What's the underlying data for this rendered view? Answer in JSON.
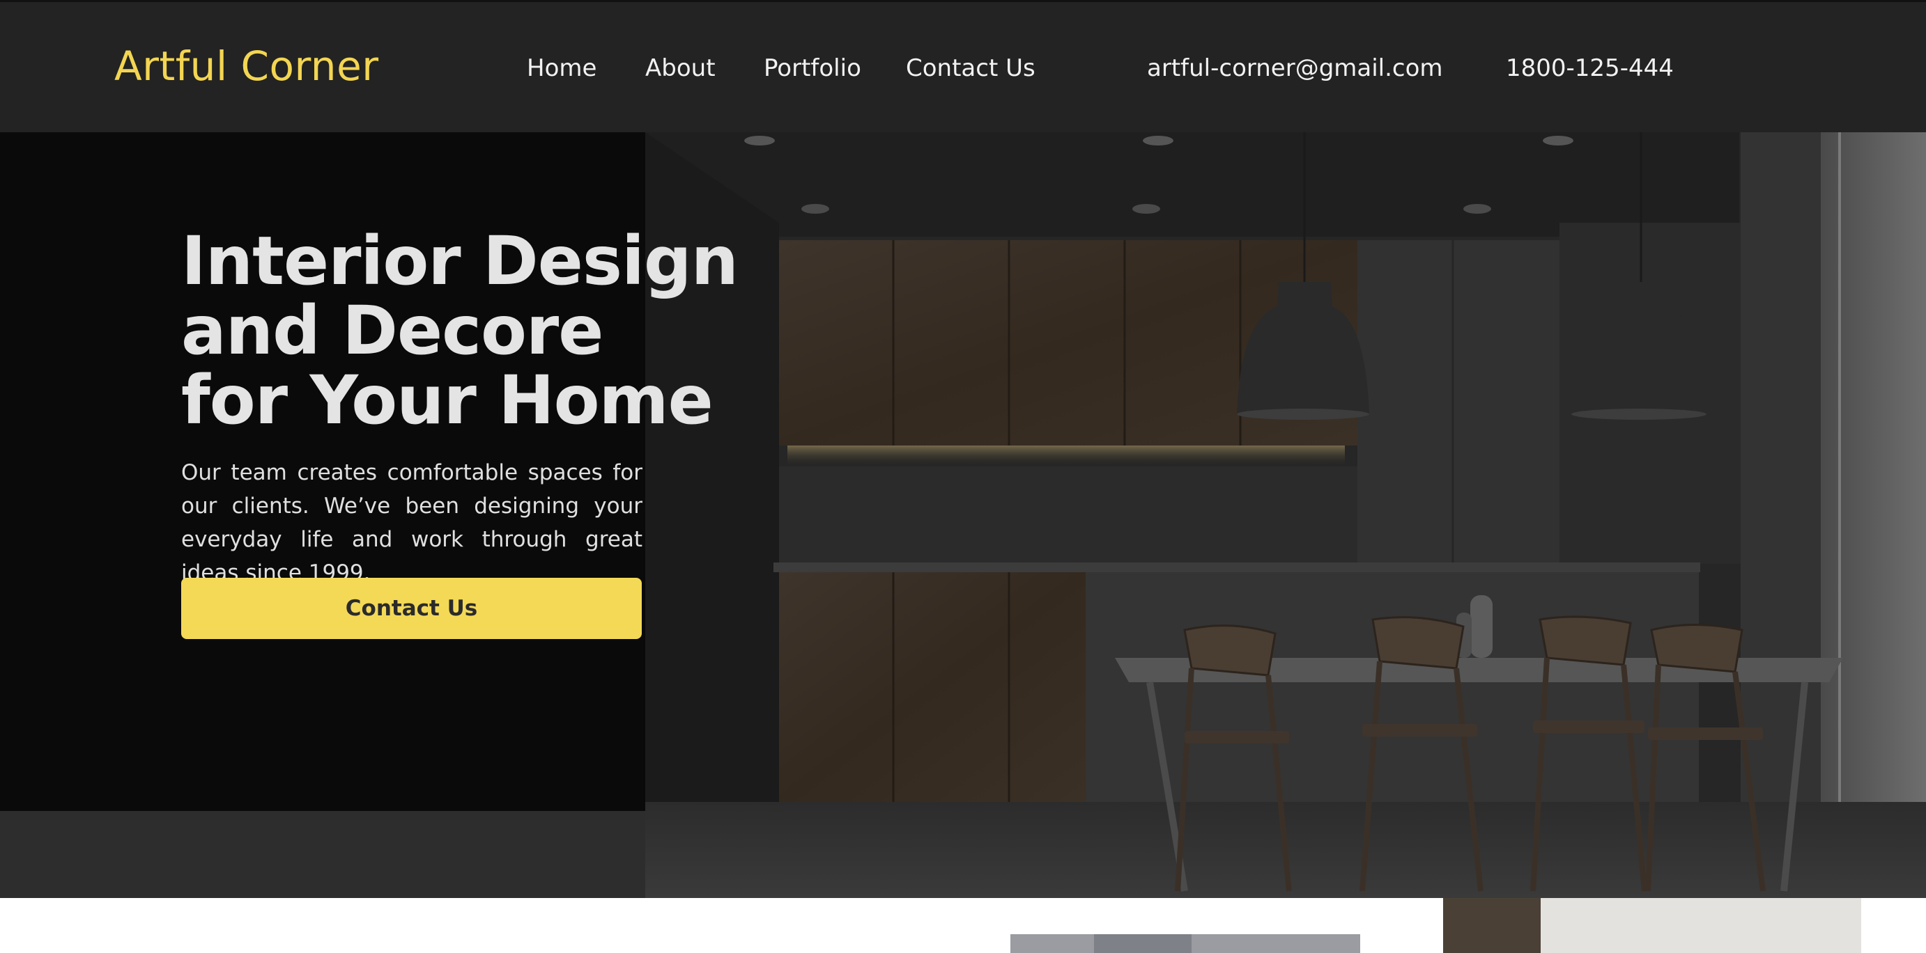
{
  "brand": {
    "name": "Artful Corner"
  },
  "nav": {
    "items": [
      "Home",
      "About",
      "Portfolio",
      "Contact Us"
    ],
    "email": "artful-corner@gmail.com",
    "phone": "1800-125-444"
  },
  "hero": {
    "title_lines": [
      "Interior Design",
      "and Decore",
      "for Your Home"
    ],
    "description": "Our team creates comfortable spaces for our clients. We’ve been designing your everyday life and work through great ideas since 1999.",
    "cta_label": "Contact Us",
    "image_subject": "dark kitchen interior with wooden cabinets, pendant lamps and dining table with chairs"
  },
  "colors": {
    "accent": "#f4d957",
    "navbar_bg": "#232323",
    "hero_bg": "#0a0a0a",
    "nav_text": "#f2f2f2"
  }
}
